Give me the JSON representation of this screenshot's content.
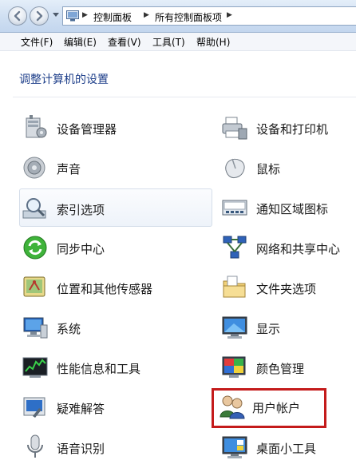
{
  "address_bar": {
    "breadcrumbs": [
      "控制面板",
      "所有控制面板项"
    ]
  },
  "menu": [
    "文件(F)",
    "编辑(E)",
    "查看(V)",
    "工具(T)",
    "帮助(H)"
  ],
  "page_title": "调整计算机的设置",
  "items": {
    "left": [
      {
        "label": "设备管理器",
        "icon": "device-manager-icon"
      },
      {
        "label": "声音",
        "icon": "speaker-icon"
      },
      {
        "label": "索引选项",
        "icon": "magnifier-icon"
      },
      {
        "label": "同步中心",
        "icon": "sync-icon"
      },
      {
        "label": "位置和其他传感器",
        "icon": "location-sensor-icon"
      },
      {
        "label": "系统",
        "icon": "computer-icon"
      },
      {
        "label": "性能信息和工具",
        "icon": "performance-chart-icon"
      },
      {
        "label": "疑难解答",
        "icon": "troubleshoot-icon"
      },
      {
        "label": "语音识别",
        "icon": "microphone-icon"
      }
    ],
    "right": [
      {
        "label": "设备和打印机",
        "icon": "printer-icon"
      },
      {
        "label": "鼠标",
        "icon": "mouse-icon"
      },
      {
        "label": "通知区域图标",
        "icon": "notification-area-icon"
      },
      {
        "label": "网络和共享中心",
        "icon": "network-icon"
      },
      {
        "label": "文件夹选项",
        "icon": "folder-options-icon"
      },
      {
        "label": "显示",
        "icon": "display-icon"
      },
      {
        "label": "颜色管理",
        "icon": "color-management-icon"
      },
      {
        "label": "用户帐户",
        "icon": "user-accounts-icon"
      },
      {
        "label": "桌面小工具",
        "icon": "desktop-gadgets-icon"
      }
    ]
  },
  "colors": {
    "title": "#1e3f8a",
    "highlight_border": "#c41b1b"
  }
}
